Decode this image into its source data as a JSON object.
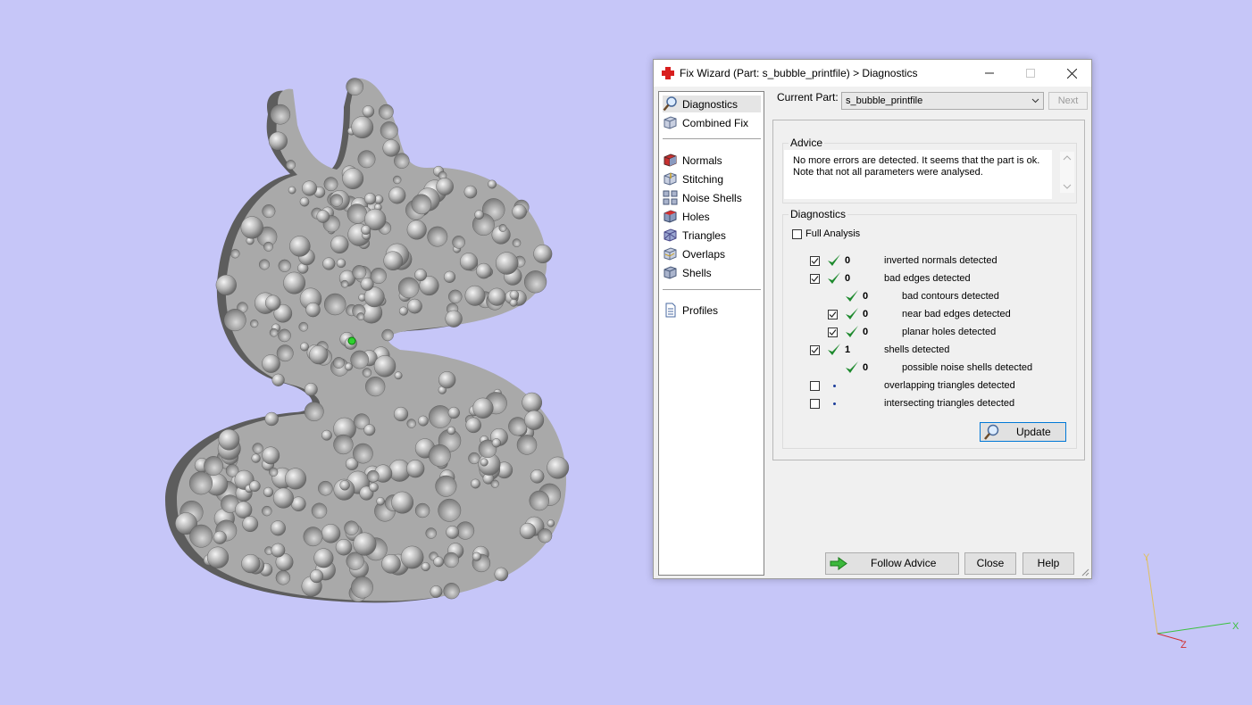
{
  "window": {
    "title": "Fix Wizard (Part: s_bubble_printfile) > Diagnostics"
  },
  "nav": {
    "items": [
      {
        "label": "Diagnostics",
        "icon": "diagnostics-magnifier-icon"
      },
      {
        "label": "Combined Fix",
        "icon": "combined-fix-cube-icon"
      },
      {
        "label": "Normals",
        "icon": "normals-cube-icon"
      },
      {
        "label": "Stitching",
        "icon": "stitching-cube-icon"
      },
      {
        "label": "Noise Shells",
        "icon": "noise-shells-cube-icon"
      },
      {
        "label": "Holes",
        "icon": "holes-cube-icon"
      },
      {
        "label": "Triangles",
        "icon": "triangles-cube-icon"
      },
      {
        "label": "Overlaps",
        "icon": "overlaps-cube-icon"
      },
      {
        "label": "Shells",
        "icon": "shells-cube-icon"
      },
      {
        "label": "Profiles",
        "icon": "profiles-document-icon"
      }
    ]
  },
  "current_part": {
    "label": "Current Part:",
    "value": "s_bubble_printfile",
    "next_label": "Next"
  },
  "advice": {
    "title": "Advice",
    "line1": "No more errors are detected. It seems that the part is ok.",
    "line2": "Note that not all parameters were analysed."
  },
  "diagnostics": {
    "title": "Diagnostics",
    "full_analysis_label": "Full Analysis",
    "full_analysis_checked": false,
    "rows": [
      {
        "checked": true,
        "value": "0",
        "label": "inverted normals detected"
      },
      {
        "checked": true,
        "value": "0",
        "label": "bad edges detected"
      },
      {
        "value": "0",
        "label": "bad contours detected"
      },
      {
        "checked": true,
        "value": "0",
        "label": "near bad edges detected"
      },
      {
        "checked": true,
        "value": "0",
        "label": "planar holes detected"
      },
      {
        "checked": true,
        "value": "1",
        "label": "shells detected"
      },
      {
        "value": "0",
        "label": "possible noise shells detected"
      },
      {
        "checked": false,
        "label": "overlapping triangles detected"
      },
      {
        "checked": false,
        "label": "intersecting triangles detected"
      }
    ],
    "update_label": "Update"
  },
  "buttons": {
    "follow_advice": "Follow Advice",
    "close": "Close",
    "help": "Help"
  },
  "axes": {
    "x": "X",
    "y": "Y",
    "z": "Z"
  },
  "colors": {
    "background": "#c6c6f8",
    "tick_green": "#1e8a2e",
    "model_gray": "#a8a8a8"
  }
}
